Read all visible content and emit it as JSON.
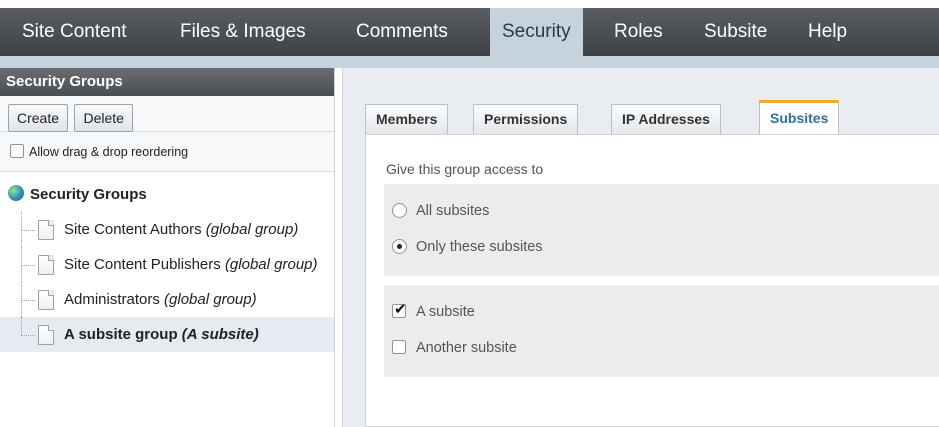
{
  "topnav": {
    "items": [
      {
        "label": "Site Content"
      },
      {
        "label": "Files & Images"
      },
      {
        "label": "Comments"
      },
      {
        "label": "Security",
        "active": true
      },
      {
        "label": "Roles"
      },
      {
        "label": "Subsite"
      },
      {
        "label": "Help"
      }
    ]
  },
  "left_panel": {
    "title": "Security Groups",
    "create_label": "Create",
    "delete_label": "Delete",
    "drag_label": "Allow drag & drop reordering",
    "drag_checked": false,
    "tree": {
      "root": "Security Groups",
      "items": [
        {
          "name": "Site Content Authors",
          "note": "(global group)"
        },
        {
          "name": "Site Content Publishers",
          "note": "(global group)"
        },
        {
          "name": "Administrators",
          "note": "(global group)"
        },
        {
          "name": "A subsite group",
          "note": "(A subsite)",
          "selected": true
        }
      ]
    }
  },
  "right_panel": {
    "tabs": [
      {
        "label": "Members"
      },
      {
        "label": "Permissions"
      },
      {
        "label": "IP Addresses"
      },
      {
        "label": "Subsites",
        "active": true
      }
    ],
    "prompt": "Give this group access to",
    "access_options": [
      {
        "label": "All subsites",
        "selected": false
      },
      {
        "label": "Only these subsites",
        "selected": true
      }
    ],
    "subsites": [
      {
        "label": "A subsite",
        "checked": true
      },
      {
        "label": "Another subsite",
        "checked": false
      }
    ]
  },
  "colors": {
    "nav_bg": "#4a4e52",
    "nav_active": "#c6d2dc",
    "tab_active_accent": "#f0a830",
    "tab_active_text": "#2f6ea6"
  }
}
